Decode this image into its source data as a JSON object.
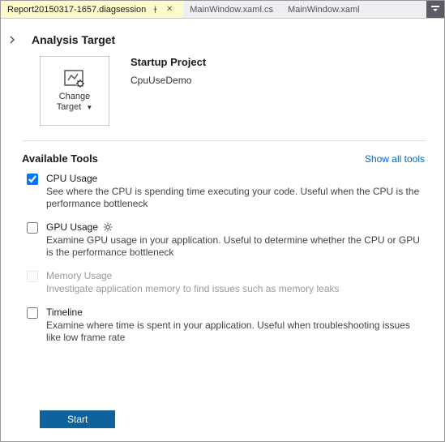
{
  "tabs": {
    "t0": {
      "label": "Report20150317-1657.diagsession"
    },
    "t1": {
      "label": "MainWindow.xaml.cs"
    },
    "t2": {
      "label": "MainWindow.xaml"
    }
  },
  "page": {
    "analysis_target_heading": "Analysis Target",
    "change_target_line1": "Change",
    "change_target_line2": "Target",
    "startup_project_heading": "Startup Project",
    "project_name": "CpuUseDemo",
    "available_tools_heading": "Available Tools",
    "show_all_link": "Show all tools",
    "start_button": "Start"
  },
  "tools": {
    "cpu": {
      "title": "CPU Usage",
      "desc": "See where the CPU is spending time executing your code. Useful when the CPU is the performance bottleneck",
      "checked": true,
      "enabled": true
    },
    "gpu": {
      "title": "GPU Usage",
      "desc": "Examine GPU usage in your application. Useful to determine whether the CPU or GPU is the performance bottleneck",
      "checked": false,
      "enabled": true,
      "has_gear": true
    },
    "mem": {
      "title": "Memory Usage",
      "desc": "Investigate application memory to find issues such as memory leaks",
      "checked": false,
      "enabled": false
    },
    "tl": {
      "title": "Timeline",
      "desc": "Examine where time is spent in your application. Useful when troubleshooting issues like low frame rate",
      "checked": false,
      "enabled": true
    }
  }
}
